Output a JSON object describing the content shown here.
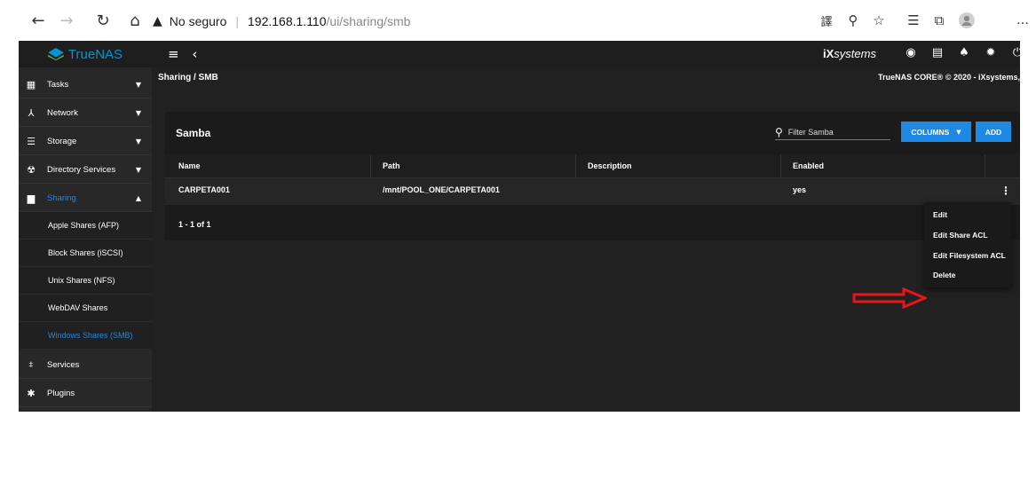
{
  "browser": {
    "security_label": "No seguro",
    "host": "192.168.1.110",
    "path": "/ui/sharing/smb"
  },
  "topbar": {
    "brand": "TrueNAS",
    "vendor_prefix": "iX",
    "vendor_suffix": "systems"
  },
  "breadcrumb": "Sharing / SMB",
  "copyright": "TrueNAS CORE® © 2020 - iXsystems,",
  "sidebar": {
    "items": [
      {
        "label": "Tasks"
      },
      {
        "label": "Network"
      },
      {
        "label": "Storage"
      },
      {
        "label": "Directory Services"
      },
      {
        "label": "Sharing"
      },
      {
        "label": "Services"
      },
      {
        "label": "Plugins"
      }
    ],
    "sharing_sub": [
      {
        "label": "Apple Shares (AFP)"
      },
      {
        "label": "Block Shares (iSCSI)"
      },
      {
        "label": "Unix Shares (NFS)"
      },
      {
        "label": "WebDAV Shares"
      },
      {
        "label": "Windows Shares (SMB)"
      }
    ]
  },
  "card": {
    "title": "Samba",
    "filter_placeholder": "Filter Samba",
    "columns_button": "COLUMNS",
    "add_button": "ADD",
    "headers": [
      "Name",
      "Path",
      "Description",
      "Enabled"
    ],
    "rows": [
      {
        "name": "CARPETA001",
        "path": "/mnt/POOL_ONE/CARPETA001",
        "description": "",
        "enabled": "yes"
      }
    ],
    "pager": "1 - 1 of 1"
  },
  "menu": {
    "items": [
      "Edit",
      "Edit Share ACL",
      "Edit Filesystem ACL",
      "Delete"
    ]
  },
  "colors": {
    "accent": "#1e88e5",
    "annotation_arrow": "#e8161b"
  }
}
